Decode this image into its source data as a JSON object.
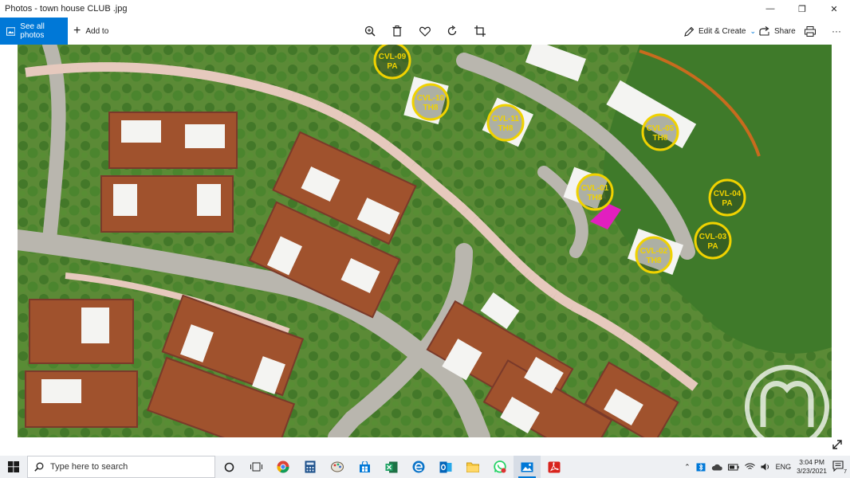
{
  "window": {
    "title": "Photos - town house CLUB .jpg",
    "minimize": "—",
    "maximize": "❐",
    "close": "✕"
  },
  "toolbar": {
    "see_all_photos": "See all photos",
    "add_to": "Add to",
    "tools": [
      "zoom-icon",
      "delete-icon",
      "heart-icon",
      "rotate-icon",
      "crop-icon"
    ],
    "edit_create": "Edit & Create",
    "share": "Share",
    "more": "···"
  },
  "map": {
    "labels": [
      {
        "code": "CVL-09",
        "type": "PA"
      },
      {
        "code": "CVL-10",
        "type": "TH8"
      },
      {
        "code": "CVL-11",
        "type": "TH8"
      },
      {
        "code": "CVL-05",
        "type": "TH8"
      },
      {
        "code": "CVL-01",
        "type": "TH8"
      },
      {
        "code": "CVL-04",
        "type": "PA"
      },
      {
        "code": "CVL-03",
        "type": "PA"
      },
      {
        "code": "CVL-02",
        "type": "TH8"
      }
    ],
    "colors": {
      "grass": "#5b8a36",
      "lawn": "#3f7a2a",
      "road": "#b9b6ae",
      "path": "#e6c9bd",
      "roof": "#f4f4f2",
      "label": "#f0d200",
      "highlight": "#e21fbf"
    }
  },
  "taskbar": {
    "search_placeholder": "Type here to search",
    "apps": [
      "task-view",
      "chrome",
      "calculator",
      "paint",
      "store",
      "excel",
      "edge",
      "outlook",
      "file-explorer",
      "whatsapp",
      "photos",
      "pdf"
    ],
    "active_app": "photos",
    "language": "ENG",
    "time": "3:04 PM",
    "date": "3/23/2021",
    "notifications": "7"
  }
}
